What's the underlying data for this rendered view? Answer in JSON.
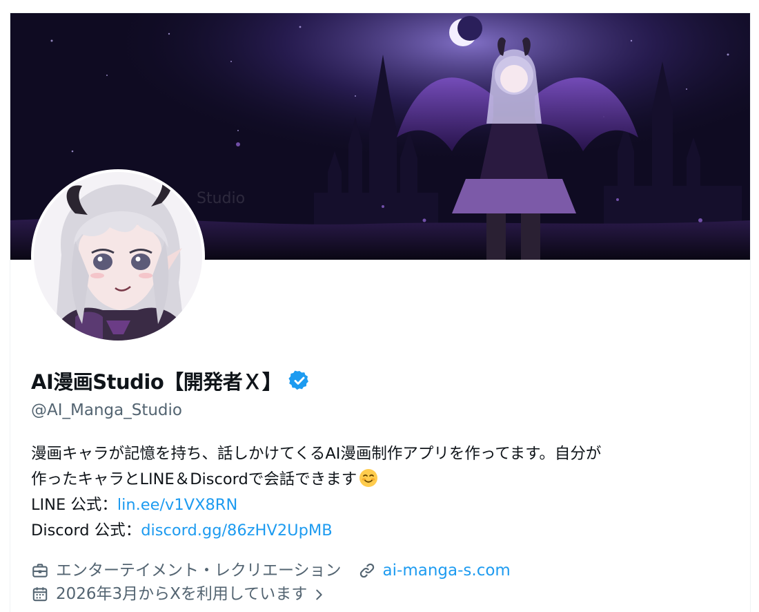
{
  "profile": {
    "display_name": "AI漫画Studio【開発者Ｘ】",
    "verified": true,
    "handle": "@AI_Manga_Studio",
    "bio": {
      "line1": "漫画キャラが記憶を持ち、話しかけてくるAI漫画制作アプリを作ってます。自分が",
      "line2": "作ったキャラとLINE＆Discordで会話できます",
      "line2_emoji": "smiling-face-emoji",
      "line_label": "LINE 公式：",
      "line_link": "lin.ee/v1VX8RN",
      "discord_label": "Discord 公式：",
      "discord_link": "discord.gg/86zHV2UpMB"
    },
    "category": "エンターテイメント・レクリエーション",
    "category_icon": "briefcase-icon",
    "website": "ai-manga-s.com",
    "website_icon": "link-icon",
    "joined": "2026年3月からXを利用しています",
    "joined_icon": "calendar-icon"
  },
  "colors": {
    "link": "#1d9bf0",
    "secondary_text": "#536471",
    "primary_text": "#0f1419",
    "verified": "#1d9bf0"
  }
}
